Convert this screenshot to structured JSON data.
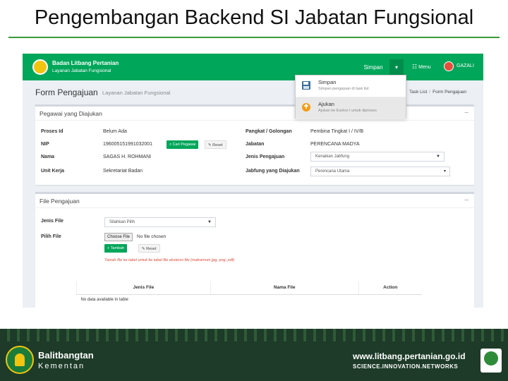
{
  "slide": {
    "title": "Pengembangan Backend SI Jabatan Fungsional"
  },
  "topbar": {
    "brand": "Badan Litbang Pertanian",
    "brand_sub": "Layanan Jabatan Fungsional",
    "simpan_label": "Simpan",
    "caret": "▾",
    "menu_icon": "☷",
    "menu_label": "Menu",
    "user_name": "GAZALI"
  },
  "header": {
    "title": "Form Pengajuan",
    "subtitle": "Layanan Jabatan Fungsional",
    "crumb1": "Task List",
    "crumb2": "Form Pengajuan",
    "crumb_sep": "/"
  },
  "dropdown": {
    "items": [
      {
        "label": "Simpan",
        "desc": "Simpan pengajuan di task list"
      },
      {
        "label": "Ajukan",
        "desc": "Ajukan ke Eselon I untuk diproses"
      }
    ]
  },
  "pegawai": {
    "title": "Pegawai yang Diajukan",
    "collapse": "–",
    "proses_label": "Proses Id",
    "proses_value": "Belum Ada",
    "nip_label": "NIP",
    "nip_value": "196005151991032001",
    "cari_label": "Cari Pegawai",
    "reset_label": "Reset",
    "nama_label": "Nama",
    "nama_value": "SAGAS H. ROHMANI",
    "unit_label": "Unit Kerja",
    "unit_value": "Sekretariat Badan",
    "pangkat_label": "Pangkat / Golongan",
    "pangkat_value": "Pembina Tingkat I / IV/B",
    "jabatan_label": "Jabatan",
    "jabatan_value": "PERENCANA MADYA",
    "jenis_label": "Jenis Pengajuan",
    "jenis_value": "Kenaikan Jabfung",
    "jabfung_label": "Jabfung yang Diajukan",
    "jabfung_value": "Perencana Utama"
  },
  "file": {
    "title": "File Pengajuan",
    "collapse": "–",
    "jenis_label": "Jenis File",
    "jenis_value": "Silahkan Pilih",
    "pilih_label": "Pilih File",
    "choose_label": "Choose File",
    "no_file": "No file chosen",
    "tambah_label": "Tambah",
    "reset_label": "Reset",
    "note": "Tamah file ke tabel untuk ke tabel file ekstensi file (maksimum jpg, png, pdf)",
    "table": {
      "columns": [
        "Jenis File",
        "Nama File",
        "Action"
      ],
      "empty": "No data available in table"
    }
  },
  "footer": {
    "org": "Balitbangtan",
    "org2": "Kementan",
    "url": "www.litbang.pertanian.go.id",
    "tagline": "SCIENCE.INNOVATION.NETWORKS"
  }
}
